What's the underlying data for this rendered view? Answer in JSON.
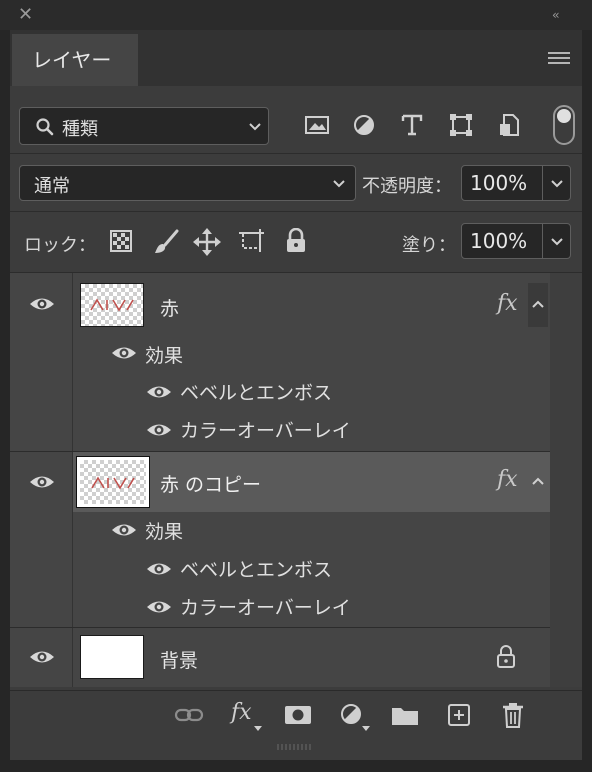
{
  "panel": {
    "tab_label": "レイヤー"
  },
  "filter": {
    "label": "種類"
  },
  "blend": {
    "mode": "通常",
    "opacity_label": "不透明度：",
    "opacity_value": "100%"
  },
  "lock": {
    "label": "ロック：",
    "fill_label": "塗り：",
    "fill_value": "100%"
  },
  "layers": [
    {
      "name": "赤",
      "effects_label": "効果",
      "effects": [
        "ベベルとエンボス",
        "カラーオーバーレイ"
      ]
    },
    {
      "name": "赤 のコピー",
      "effects_label": "効果",
      "effects": [
        "ベベルとエンボス",
        "カラーオーバーレイ"
      ]
    },
    {
      "name": "背景"
    }
  ],
  "icons": {
    "fx": "fx",
    "collapse_caret": "^",
    "dropdown_caret": "v"
  },
  "colors": {
    "panel_bg": "#3c3c3c",
    "selected_layer": "#5a5a5a",
    "input_bg": "#262626",
    "text": "#d6d6d6"
  }
}
